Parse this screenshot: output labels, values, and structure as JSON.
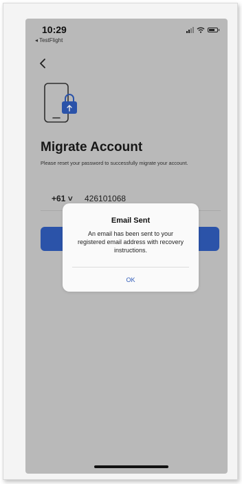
{
  "status_bar": {
    "time": "10:29",
    "back_app": "◂ TestFlight"
  },
  "screen": {
    "back_icon": "chevron-left-icon",
    "illustration_icon": "phone-lock-upload-icon",
    "title": "Migrate Account",
    "subtitle": "Please reset your password to successfully migrate your account.",
    "country_code": "+61 ˅",
    "phone_number": "426101068"
  },
  "dialog": {
    "title": "Email Sent",
    "message": "An email has been sent to your registered email address with recovery instructions.",
    "ok_label": "OK"
  },
  "colors": {
    "accent": "#2f5bb8",
    "background": "#c9c9c9",
    "dialog": "#fafafa"
  }
}
